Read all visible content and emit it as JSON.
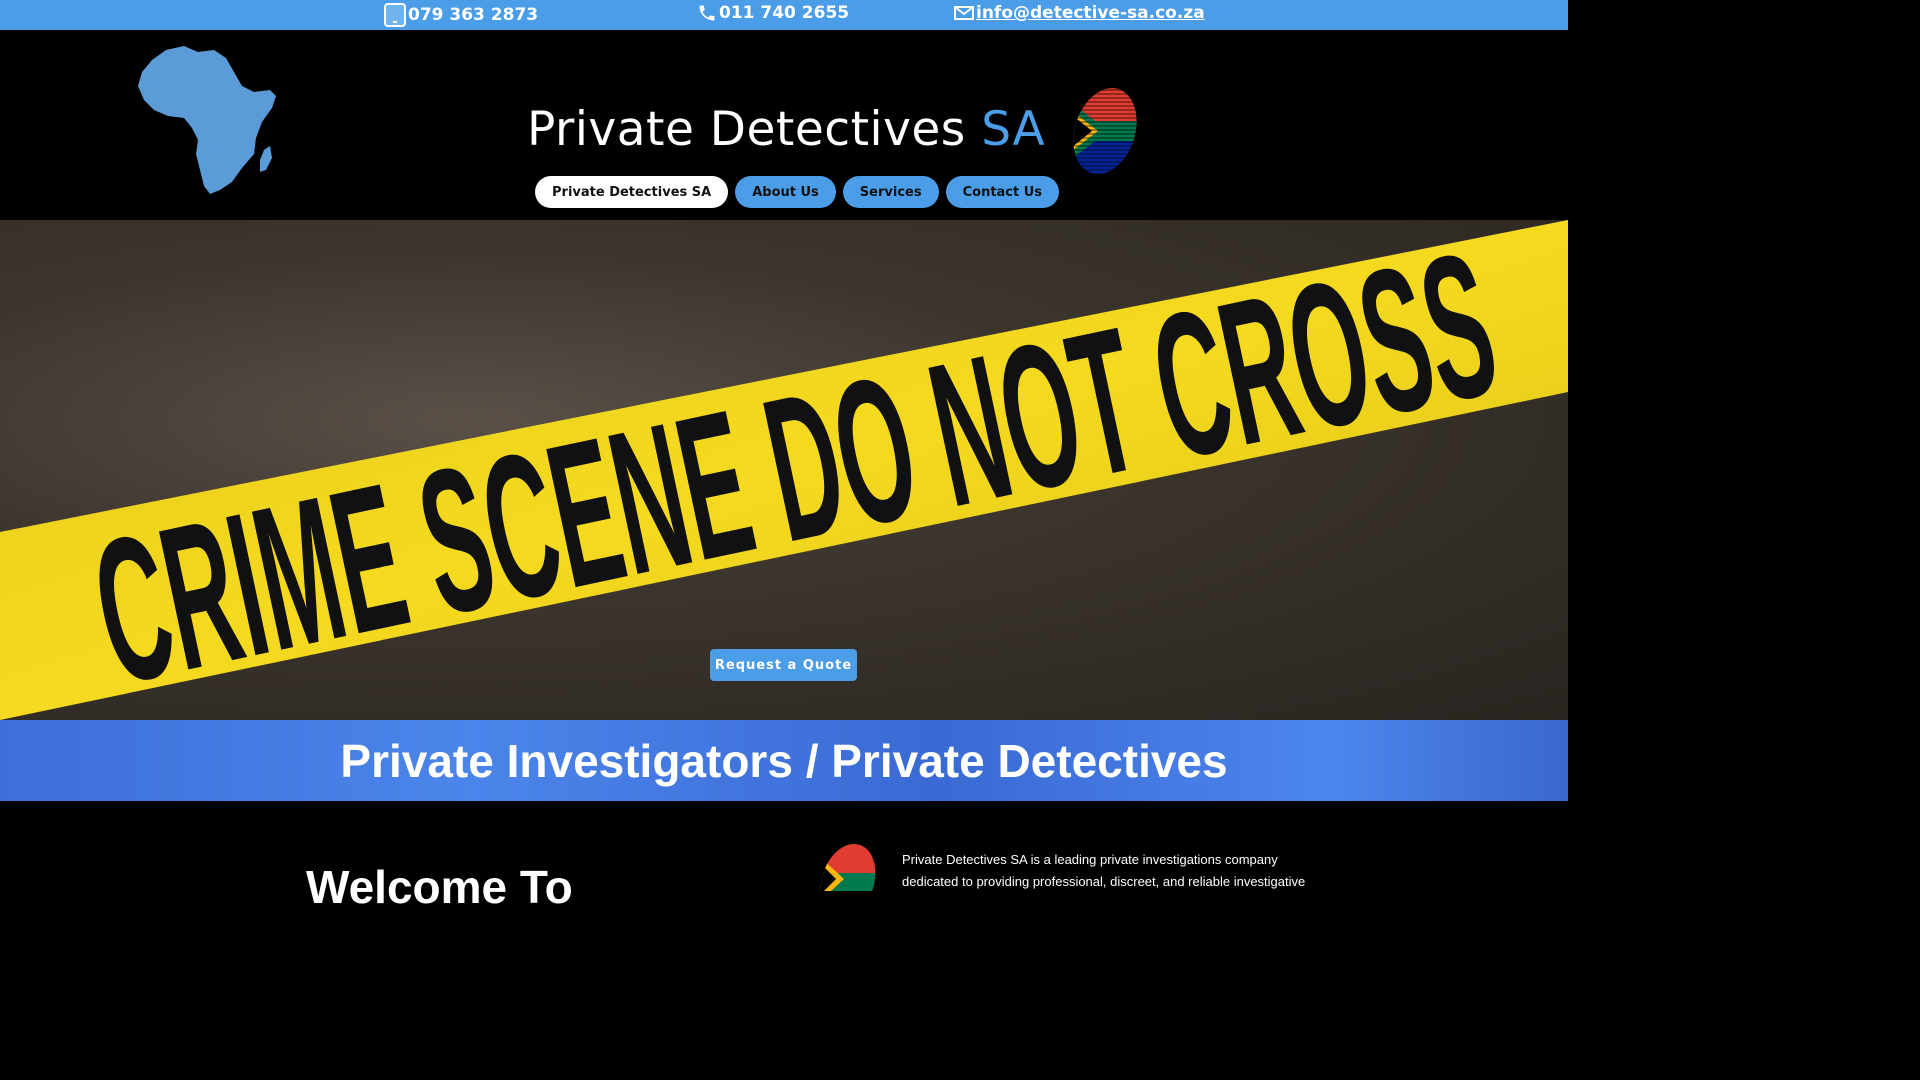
{
  "contacts": {
    "mobile": "079 363 2873",
    "phone": "011 740 2655",
    "email": "info@detective-sa.co.za",
    "mobile_icon": "mobile-phone-icon",
    "phone_icon": "phone-icon",
    "email_icon": "envelope-icon"
  },
  "header": {
    "title_main": "Private Detectives ",
    "title_accent": "SA"
  },
  "nav": {
    "items": [
      "Private Detectives SA",
      "About Us",
      "Services",
      "Contact Us"
    ],
    "active": "Private Detectives SA"
  },
  "hero": {
    "tape_text": "CRIME SCENE DO NOT CROSS",
    "cta_label": "Request a Quote"
  },
  "banner": {
    "title": "Private Investigators / Private Detectives"
  },
  "intro": {
    "heading": "Welcome To",
    "text": "Private Detectives SA is a leading private investigations company dedicated to providing professional, discreet, and reliable investigative"
  },
  "colors": {
    "accent": "#4a9de6",
    "tape": "#f0d21a",
    "background": "#000000"
  }
}
